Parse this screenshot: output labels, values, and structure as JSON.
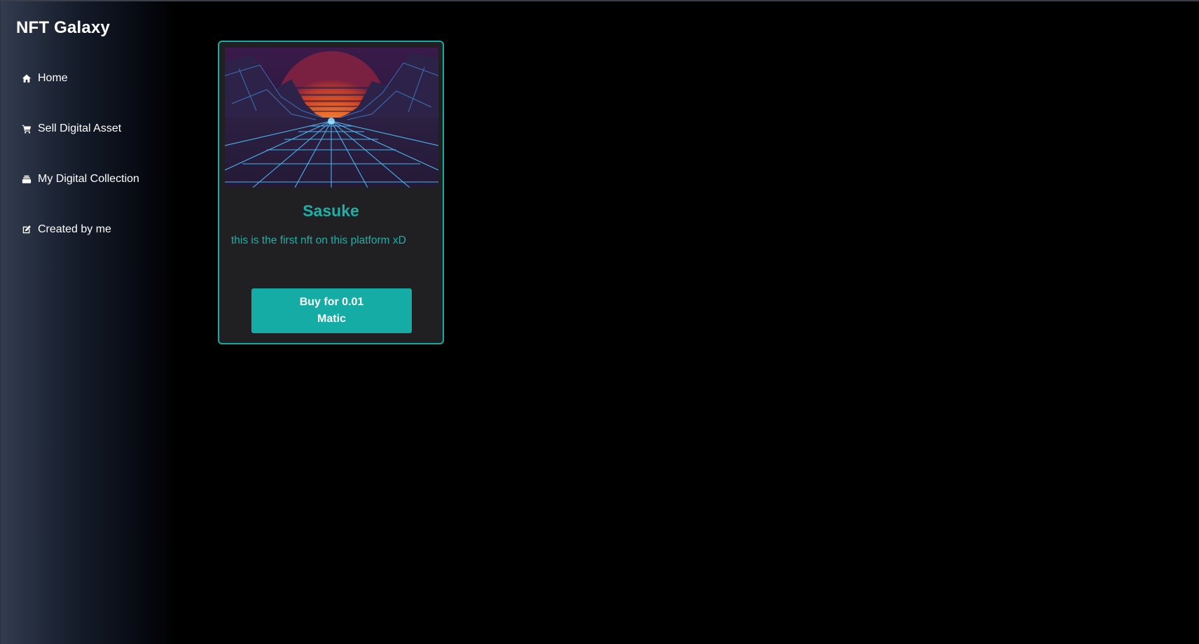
{
  "app": {
    "brand": "NFT Galaxy"
  },
  "sidebar": {
    "items": [
      {
        "label": "Home",
        "icon": "home-icon"
      },
      {
        "label": "Sell Digital Asset",
        "icon": "cart-icon"
      },
      {
        "label": "My Digital Collection",
        "icon": "collection-icon"
      },
      {
        "label": "Created by me",
        "icon": "edit-icon"
      }
    ]
  },
  "listing": {
    "title": "Sasuke",
    "description": "this is the first nft on this platform xD",
    "buy_label": "Buy for 0.01 Matic"
  },
  "colors": {
    "accent": "#14aca4",
    "card_bg": "#202022",
    "background": "#000000"
  }
}
